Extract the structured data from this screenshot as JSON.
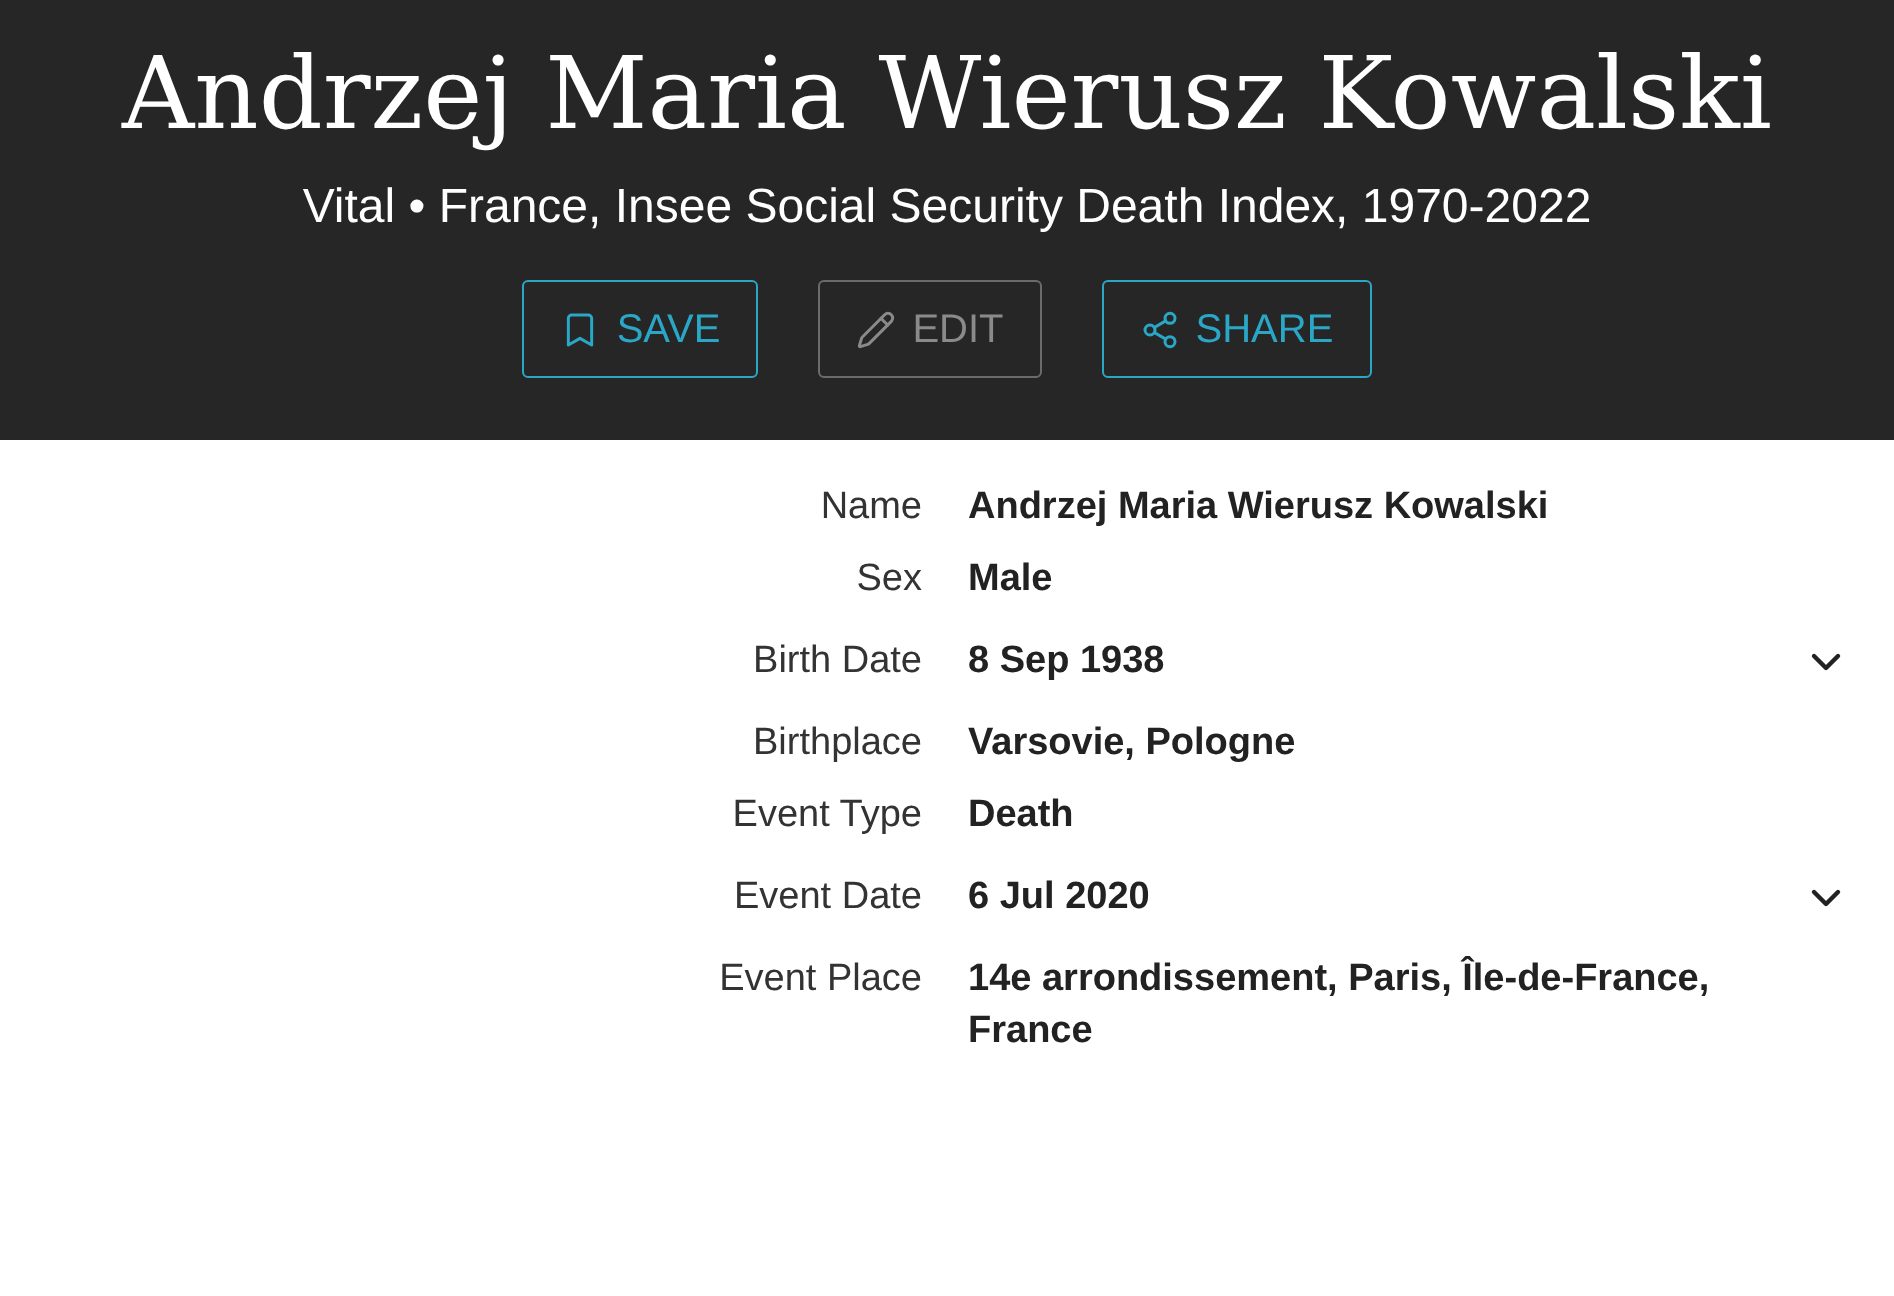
{
  "header": {
    "title": "Andrzej Maria Wierusz Kowalski",
    "subtitle": "Vital • France, Insee Social Security Death Index, 1970-2022",
    "buttons": [
      {
        "label": "SAVE",
        "kind": "save",
        "disabled": false
      },
      {
        "label": "EDIT",
        "kind": "edit",
        "disabled": true
      },
      {
        "label": "SHARE",
        "kind": "share",
        "disabled": false
      }
    ]
  },
  "fields": [
    {
      "label": "Name",
      "value": "Andrzej Maria Wierusz Kowalski",
      "kind": "plain"
    },
    {
      "label": "Sex",
      "value": "Male",
      "kind": "plain"
    },
    {
      "label": "Birth Date",
      "value": "8 Sep 1938",
      "kind": "expandable",
      "expanded": false
    },
    {
      "label": "Birthplace",
      "value": "Varsovie, Pologne",
      "kind": "plain"
    },
    {
      "label": "Event Type",
      "value": "Death",
      "kind": "plain"
    },
    {
      "label": "Event Date",
      "value": "6 Jul 2020",
      "kind": "expandable",
      "expanded": false
    },
    {
      "label": "Event Place",
      "value": "14e arrondissement, Paris, Île-de-France, France",
      "kind": "plain"
    }
  ]
}
